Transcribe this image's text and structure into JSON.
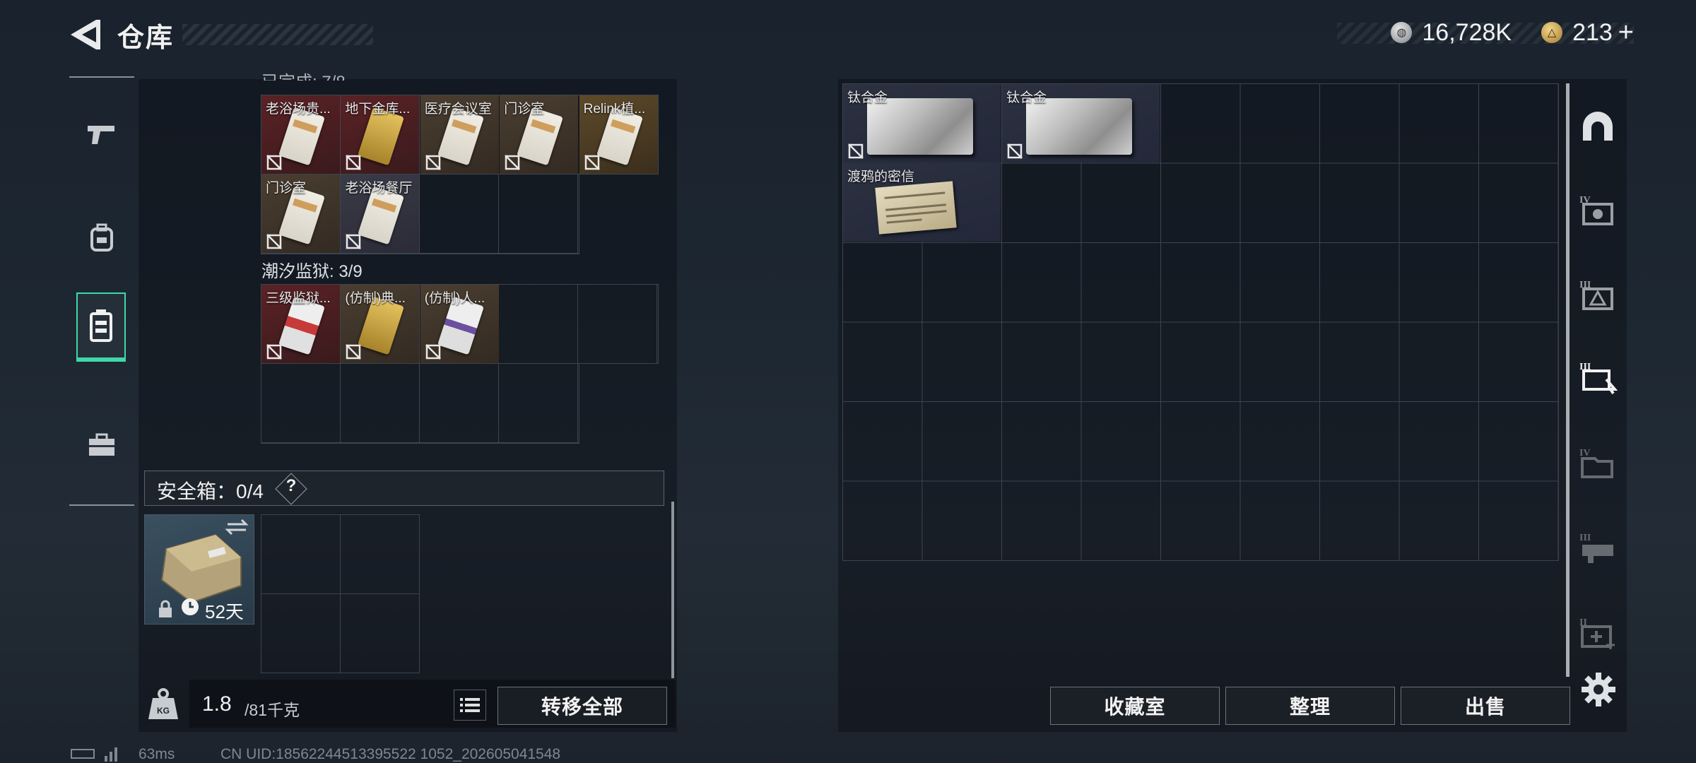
{
  "header": {
    "title": "仓库",
    "currency_primary": "16,728K",
    "currency_secondary": "213",
    "currency_secondary_add": "+"
  },
  "left_nav": {
    "items": [
      {
        "name": "weapons",
        "icon": "pistol-icon",
        "active": false
      },
      {
        "name": "backpack",
        "icon": "backpack-icon",
        "active": false
      },
      {
        "name": "storage",
        "icon": "locker-icon",
        "active": true
      },
      {
        "name": "toolbox",
        "icon": "toolbox-icon",
        "active": false
      }
    ]
  },
  "keycards": {
    "section1": [
      {
        "name": "老浴场贵...",
        "bg": "red",
        "card": "white"
      },
      {
        "name": "地下金库...",
        "bg": "red",
        "card": "gold"
      },
      {
        "name": "医疗会议室",
        "bg": "brown",
        "card": "white"
      },
      {
        "name": "门诊室",
        "bg": "brown",
        "card": "white"
      },
      {
        "name": "Relink植...",
        "bg": "gold",
        "card": "white"
      },
      {
        "name": "门诊室",
        "bg": "brown",
        "card": "white"
      },
      {
        "name": "老浴场餐厅",
        "bg": "gray",
        "card": "white"
      }
    ],
    "section2_label": "潮汐监狱: 3/9",
    "section2": [
      {
        "name": "三级监狱...",
        "bg": "red",
        "card": "redstripe"
      },
      {
        "name": "(仿制)典...",
        "bg": "brown",
        "card": "gold"
      },
      {
        "name": "(仿制)人...",
        "bg": "brown",
        "card": "purple"
      }
    ]
  },
  "safebox": {
    "label": "安全箱：0/4",
    "help": "?",
    "days": "52天"
  },
  "weight": {
    "current": "1.8",
    "max": "/81千克",
    "icon_text": "KG"
  },
  "buttons": {
    "transfer_all": "转移全部",
    "collection": "收藏室",
    "organize": "整理",
    "sell": "出售"
  },
  "stash_items": [
    {
      "name": "钛合金",
      "type": "ingot"
    },
    {
      "name": "钛合金",
      "type": "ingot"
    },
    {
      "name": "渡鸦的密信",
      "type": "letter"
    }
  ],
  "right_tabs": [
    "arch-icon",
    "tier-iv-case-icon",
    "tier-iii-case-icon",
    "tier-iii-keycard-case-icon",
    "tier-iv-folder-icon",
    "tier-iii-tool-icon",
    "tier-ii-medkit-icon"
  ],
  "status": {
    "ping": "63ms",
    "uid": "CN UID:18562244513395522 1052_202605041548"
  }
}
